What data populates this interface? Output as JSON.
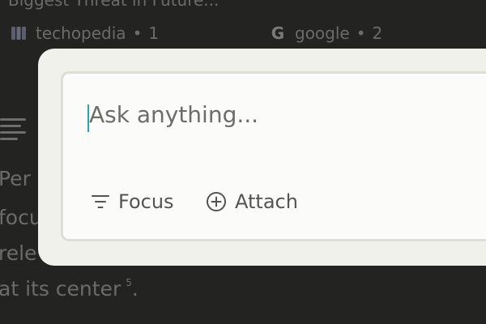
{
  "background": {
    "top_text": "Biggest Threat in Future...",
    "sources": [
      {
        "name": "techopedia",
        "count": "1",
        "icon": "techopedia-logo-icon"
      },
      {
        "name": "google",
        "count": "2",
        "icon": "google-logo-icon",
        "logo_letter": "G"
      }
    ],
    "separator": "•",
    "paragraph_lines": [
      "Per",
      "focu",
      "rele",
      "at its center"
    ],
    "footnote": "5",
    "trailing_period": "."
  },
  "modal": {
    "input": {
      "placeholder": "Ask anything..."
    },
    "tools": {
      "focus_label": "Focus",
      "attach_label": "Attach"
    }
  },
  "colors": {
    "background_dim": "#232322",
    "modal_bg": "#f1f1ec",
    "input_bg": "#fbfbf9",
    "caret": "#1fa8b8",
    "tool_text": "#55554f"
  }
}
